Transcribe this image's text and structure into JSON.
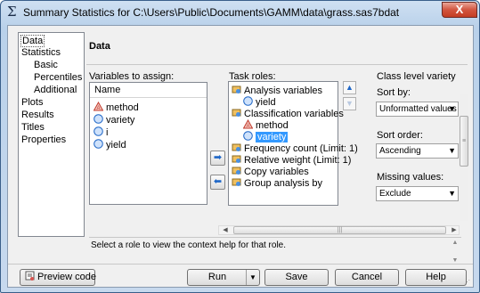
{
  "window": {
    "title": "Summary Statistics for C:\\Users\\Public\\Documents\\GAMM\\data\\grass.sas7bdat",
    "icon_glyph": "Σ",
    "close_label": "X"
  },
  "nav": {
    "items": [
      "Data",
      "Statistics",
      "Basic",
      "Percentiles",
      "Additional",
      "Plots",
      "Results",
      "Titles",
      "Properties"
    ]
  },
  "panel": {
    "title": "Data",
    "vars_label": "Variables to assign:",
    "vars_header": "Name",
    "variables": [
      {
        "name": "method",
        "icon": "character-variable-icon"
      },
      {
        "name": "variety",
        "icon": "numeric-variable-icon"
      },
      {
        "name": "i",
        "icon": "numeric-variable-icon"
      },
      {
        "name": "yield",
        "icon": "numeric-variable-icon"
      }
    ],
    "roles_label": "Task roles:",
    "roles": [
      {
        "label": "Analysis variables",
        "type": "group"
      },
      {
        "label": "yield",
        "type": "child-numeric"
      },
      {
        "label": "Classification variables",
        "type": "group"
      },
      {
        "label": "method",
        "type": "child-character"
      },
      {
        "label": "variety",
        "type": "child-numeric-selected"
      },
      {
        "label": "Frequency count (Limit: 1)",
        "type": "group"
      },
      {
        "label": "Relative weight (Limit: 1)",
        "type": "group"
      },
      {
        "label": "Copy variables",
        "type": "group"
      },
      {
        "label": "Group analysis by",
        "type": "group"
      }
    ],
    "options_title": "Class level variety",
    "sort_by_label": "Sort by:",
    "sort_by_value": "Unformatted values",
    "sort_order_label": "Sort order:",
    "sort_order_value": "Ascending",
    "missing_label": "Missing values:",
    "missing_value": "Exclude",
    "help_text": "Select a role to view the context help for that role."
  },
  "buttons": {
    "preview": "Preview code",
    "run": "Run",
    "save": "Save",
    "cancel": "Cancel",
    "help": "Help"
  },
  "colors": {
    "selection": "#3399ff",
    "character_icon": "#c0392b",
    "numeric_icon": "#1e66c7",
    "close_button": "#c43d23"
  }
}
